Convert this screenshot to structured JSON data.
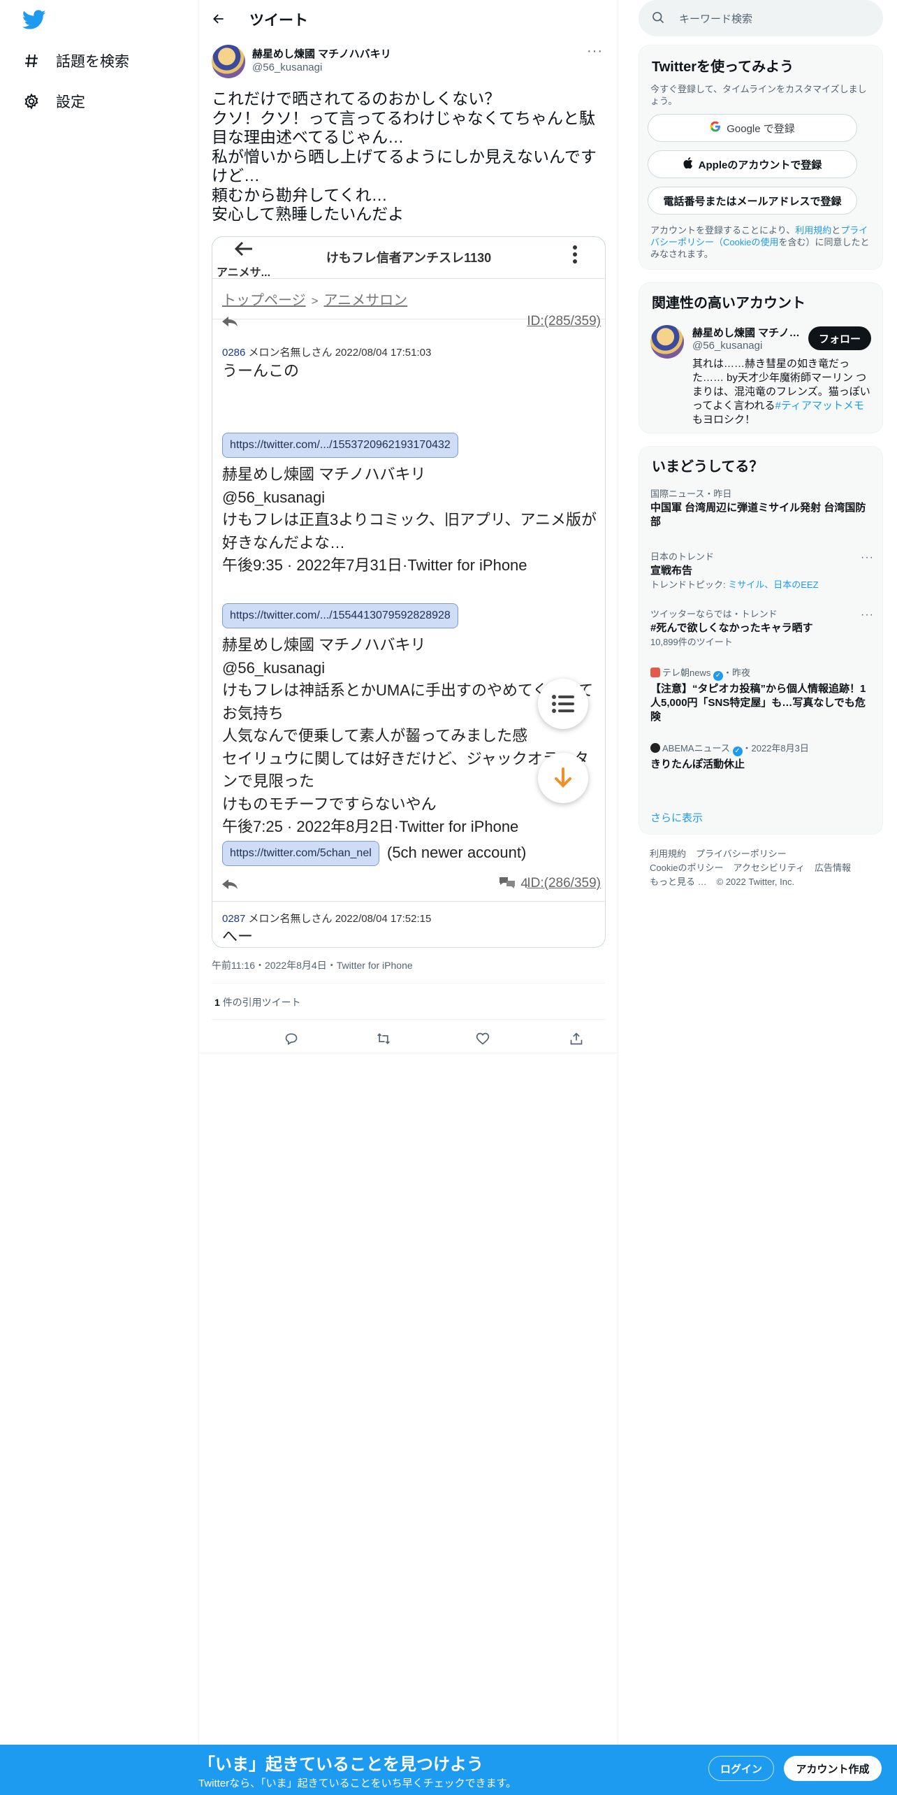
{
  "nav": {
    "explore": "話題を検索",
    "settings": "設定"
  },
  "header": {
    "title": "ツイート"
  },
  "tweet": {
    "author_name": "赫星めし煉國 マチノハバキリ",
    "author_handle": "@56_kusanagi",
    "text": "これだけで晒されてるのおかしくない？\nクソ！クソ！って言ってるわけじゃなくてちゃんと駄目な理由述べてるじゃん…\n私が憎いから晒し上げてるようにしか見えないんですけど…\n頼むから勘弁してくれ…\n安心して熟睡したいんだよ",
    "timestamp": "午前11:16・2022年8月4日・Twitter for iPhone",
    "quote_count": "1",
    "quote_label": "件の引用ツイート"
  },
  "screenshot": {
    "back_label": "アニメサ...",
    "title": "けもフレ信者アンチスレ1130",
    "crumb_home": "トップページ",
    "crumb_sep": ">",
    "crumb_board": "アニメサロン",
    "id_prev": "ID:(285/359)",
    "post1_header_num": "0286",
    "post1_header_rest": "メロン名無しさん 2022/08/04 17:51:03",
    "post1_first": "うーんこの",
    "url1": "https://twitter.com/.../1553720962193170432",
    "quote1": "赫星めし煉國 マチノハバキリ\n@56_kusanagi\nけもフレは正直3よりコミック、旧アプリ、アニメ版が好きなんだよな…\n午後9:35 · 2022年7月31日·Twitter for iPhone",
    "url2": "https://twitter.com/.../1554413079592828928",
    "quote2": "赫星めし煉國 マチノハバキリ\n@56_kusanagi\nけもフレは神話系とかUMAに手出すのやめてくれってお気持ち\n人気なんで便乗して素人が齧ってみました感\nセイリュウに関しては好きだけど、ジャックオランタンで見限った\nけものモチーフですらないやん\n午後7:25 · 2022年8月2日·Twitter for iPhone",
    "url3": "https://twitter.com/5chan_nel",
    "url3_after": "(5ch newer account)",
    "comment_count": "4",
    "id_current": "ID:(286/359)",
    "post2_header_num": "0287",
    "post2_header_rest": "メロン名無しさん 2022/08/04 17:52:15",
    "post2_first": "へー"
  },
  "search": {
    "placeholder": "キーワード検索"
  },
  "signup": {
    "title": "Twitterを使ってみよう",
    "subtitle": "今すぐ登録して、タイムラインをカスタマイズしましょう。",
    "google": "Google で登録",
    "apple": "Appleのアカウントで登録",
    "phone": "電話番号またはメールアドレスで登録",
    "legal_pre": "アカウントを登録することにより、",
    "legal_terms": "利用規約",
    "legal_and": "と",
    "legal_privacy": "プライバシーポリシー（Cookieの使用",
    "legal_post": "を含む）に同意したとみなされます。"
  },
  "related": {
    "title": "関連性の高いアカウント",
    "name": "赫星めし煉國 マチノハバキリ",
    "handle": "@56_kusanagi",
    "follow": "フォロー",
    "bio": "其れは……赫き彗星の如き竜だった…… by天才少年魔術師マーリン つまりは、混沌竜のフレンズ。猫っぽいってよく言われる",
    "bio_tag": "#ティアマットメモ",
    "bio_end": "もヨロシク！"
  },
  "trends": {
    "title": "いまどうしてる？",
    "items": [
      {
        "meta": "国際ニュース・昨日",
        "title": "中国軍 台湾周辺に弾道ミサイル発射 台湾国防部",
        "sub": ""
      },
      {
        "meta": "日本のトレンド",
        "title": "宣戦布告",
        "sub_pre": "トレンドトピック: ",
        "sub_links": "ミサイル、日本のEEZ"
      },
      {
        "meta": "ツイッターならでは・トレンド",
        "title": "#死んで欲しくなかったキャラ晒す",
        "sub": "10,899件のツイート"
      },
      {
        "meta_src": "テレ朝news",
        "meta_time": "・昨夜",
        "title": "【注意】“タピオカ投稿”から個人情報追跡！1人5,000円「SNS特定屋」も…写真なしでも危険"
      },
      {
        "meta_src": "ABEMAニュース",
        "meta_time": "・2022年8月3日",
        "title": "きりたんぽ活動休止"
      }
    ],
    "more": "さらに表示"
  },
  "footer": {
    "line1": [
      "利用規約",
      "プライバシーポリシー"
    ],
    "line2": [
      "Cookieのポリシー",
      "アクセシビリティ",
      "広告情報"
    ],
    "line3": [
      "もっと見る …",
      "© 2022 Twitter, Inc."
    ]
  },
  "banner": {
    "title": "「いま」起きていることを見つけよう",
    "sub": "Twitterなら、「いま」起きていることをいち早くチェックできます。",
    "login": "ログイン",
    "create": "アカウント作成"
  },
  "colors": {
    "brand": "#1d9bf0",
    "text": "#0f1419",
    "muted": "#536471",
    "fab_arrow": "#f0902a"
  }
}
